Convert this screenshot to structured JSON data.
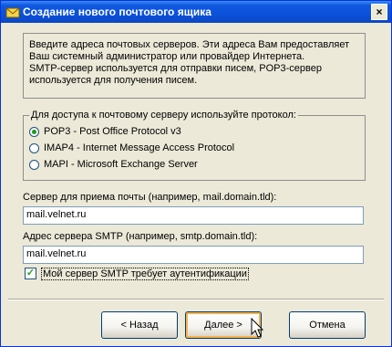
{
  "window": {
    "title": "Создание нового почтового ящика",
    "close_label": "×"
  },
  "info": {
    "lines": [
      "Введите адреса почтовых серверов. Эти адреса Вам предоставляет",
      "Ваш системный администратор или провайдер Интернета.",
      "SMTP-сервер используется для отправки писем, POP3-сервер",
      "используется для получения писем."
    ]
  },
  "protocol": {
    "legend": "Для доступа к почтовому серверу используйте протокол:",
    "options": [
      {
        "label": "POP3  -  Post Office Protocol v3",
        "checked": true
      },
      {
        "label": "IMAP4 - Internet Message Access Protocol",
        "checked": false
      },
      {
        "label": "MAPI - Microsoft Exchange Server",
        "checked": false
      }
    ]
  },
  "incoming": {
    "label": "Сервер для приема почты  (например, mail.domain.tld):",
    "value": "mail.velnet.ru"
  },
  "smtp": {
    "label": "Адрес сервера SMTP (например, smtp.domain.tld):",
    "value": "mail.velnet.ru"
  },
  "auth": {
    "label": "Мой сервер SMTP требует аутентификации",
    "checked": true
  },
  "buttons": {
    "back": "< Назад",
    "next": "Далее  >",
    "cancel": "Отмена"
  },
  "colors": {
    "titlebar": "#0a4fd8",
    "face": "#ece9d8",
    "default_button_glow": "#f7b24d"
  }
}
